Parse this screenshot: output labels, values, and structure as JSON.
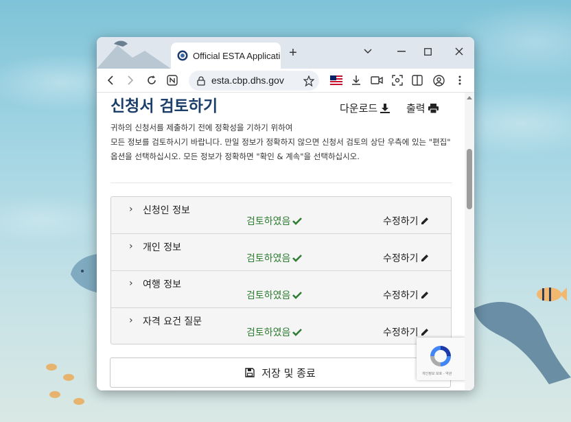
{
  "browser": {
    "tab_title": "Official ESTA Applicati",
    "new_tab": "+",
    "url": "esta.cbp.dhs.gov"
  },
  "page": {
    "title": "신청서 검토하기",
    "download_label": "다운로드",
    "print_label": "출력",
    "description_line1": "귀하의 신청서를 제출하기 전에 정확성을 기하기 위하여",
    "description_line2": "모든 정보를 검토하시기 바랍니다. 만일 정보가 정확하지 않으면 신청서 검토의 상단 우측에 있는 \"편집\" 옵션을 선택하십시오. 모든 정보가 정확하면 \"확인 & 계속\"을 선택하십시오.",
    "sections": [
      {
        "label": "신청인 정보",
        "status": "검토하였음",
        "edit": "수정하기"
      },
      {
        "label": "개인 정보",
        "status": "검토하였음",
        "edit": "수정하기"
      },
      {
        "label": "여행 정보",
        "status": "검토하였음",
        "edit": "수정하기"
      },
      {
        "label": "자격 요건 질문",
        "status": "검토하였음",
        "edit": "수정하기"
      }
    ],
    "save_exit_label": "저장 및 종료",
    "recaptcha_text": "개인정보 보호 - 약관"
  },
  "colors": {
    "title": "#1b3f6a",
    "status_green": "#2e7d32"
  }
}
